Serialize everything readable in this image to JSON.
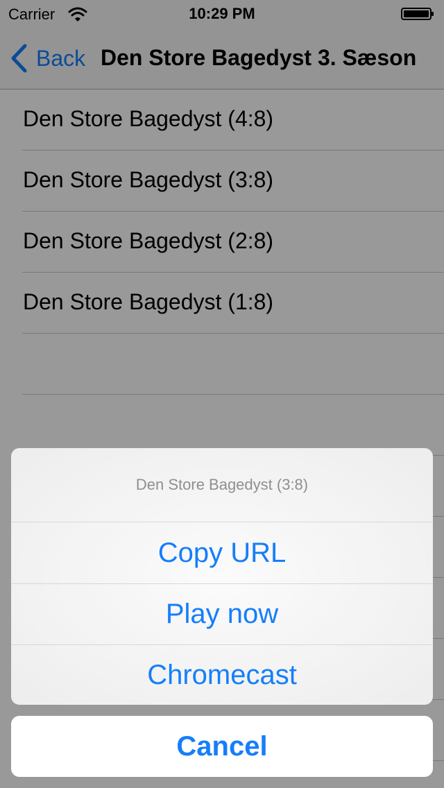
{
  "status_bar": {
    "carrier": "Carrier",
    "time": "10:29 PM",
    "wifi_icon": "wifi-icon",
    "battery_icon": "battery-icon"
  },
  "nav": {
    "back_label": "Back",
    "back_icon": "chevron-left-icon",
    "title": "Den Store Bagedyst 3. Sæson"
  },
  "list": {
    "items": [
      {
        "label": "Den Store Bagedyst (4:8)"
      },
      {
        "label": "Den Store Bagedyst (3:8)"
      },
      {
        "label": "Den Store Bagedyst (2:8)"
      },
      {
        "label": "Den Store Bagedyst (1:8)"
      },
      {
        "label": ""
      },
      {
        "label": ""
      },
      {
        "label": ""
      },
      {
        "label": ""
      },
      {
        "label": ""
      },
      {
        "label": ""
      },
      {
        "label": ""
      }
    ]
  },
  "action_sheet": {
    "title": "Den Store Bagedyst (3:8)",
    "buttons": [
      {
        "label": "Copy URL"
      },
      {
        "label": "Play now"
      },
      {
        "label": "Chromecast"
      }
    ],
    "cancel_label": "Cancel"
  },
  "colors": {
    "accent": "#157efb",
    "overlay": "rgba(0,0,0,0.4)"
  }
}
